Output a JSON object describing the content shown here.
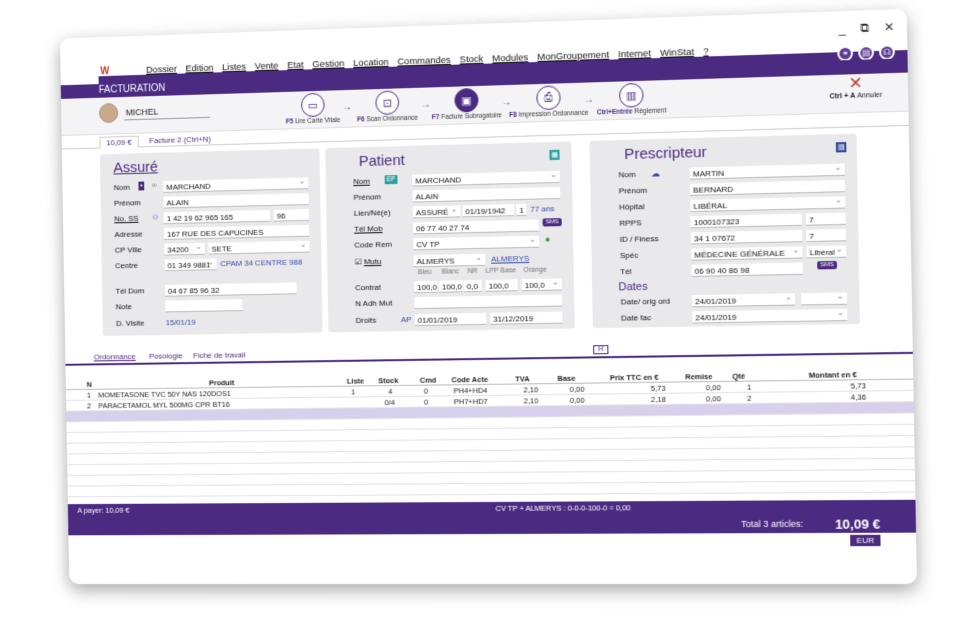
{
  "window": {
    "minimize": "_",
    "restore": "⧉",
    "close": "✕"
  },
  "menu": [
    "Dossier",
    "Edition",
    "Listes",
    "Vente",
    "Etat",
    "Gestion",
    "Location",
    "Commandes",
    "Stock",
    "Modules",
    "MonGroupement",
    "Internet",
    "WinStat",
    "?"
  ],
  "title": "FACTURATION",
  "client": "MICHEL",
  "steps": [
    {
      "key": "F5",
      "label": "Lire Carte Vitale"
    },
    {
      "key": "F6",
      "label": "Scan Ordonnance"
    },
    {
      "key": "F7",
      "label": "Facture Subrogatoire"
    },
    {
      "key": "F8",
      "label": "Impression Ordonnance"
    },
    {
      "key": "Ctrl+Entrée",
      "label": "Règlement"
    }
  ],
  "cancel": {
    "key": "Ctrl + A",
    "label": "Annuler"
  },
  "tabs": [
    "10,09 €",
    "Facture 2 (Ctrl+N)"
  ],
  "assure": {
    "title": "Assuré",
    "nom_label": "Nom",
    "nom": "MARCHAND",
    "prenom_label": "Prénom",
    "prenom": "ALAIN",
    "ss_label": "No. SS",
    "ss": "1 42 19 62 965 165",
    "ss_key": "96",
    "adresse_label": "Adresse",
    "adresse": "167 RUE DES CAPUCINES",
    "cp_label": "CP Ville",
    "cp": "34200",
    "ville": "SETE",
    "centre_label": "Centre",
    "centre": "01 349 9881",
    "centre_name": "CPAM 34 CENTRE 988",
    "tel_label": "Tél Dom",
    "tel": "04 67 85 96 32",
    "note_label": "Note",
    "visite_label": "D. Visite",
    "visite": "15/01/19"
  },
  "patient": {
    "title": "Patient",
    "nom_label": "Nom",
    "ep": "EP",
    "nom": "MARCHAND",
    "prenom_label": "Prénom",
    "prenom": "ALAIN",
    "lien_label": "Lien/Né(e)",
    "lien": "ASSURÉ",
    "dob": "01/19/1942",
    "rang": "1",
    "age": "77 ans",
    "tel_label": "Tél Mob",
    "tel": "06 77 40 27 74",
    "sms": "SMS",
    "code_label": "Code Rem",
    "code": "CV TP",
    "mutu_label": "Mutu",
    "mutu": "ALMERYS",
    "mutu_link": "ALMERYS",
    "cols": [
      "Bleu",
      "Blanc",
      "NR",
      "LPP Base",
      "Orange"
    ],
    "contrat_label": "Contrat",
    "contrat": [
      "100,0",
      "100,0",
      "0,0",
      "100,0",
      "100,0"
    ],
    "adh_label": "N Adh Mut",
    "droits_label": "Droits",
    "droits_ap": "AP",
    "droits_from": "01/01/2019",
    "droits_to": "31/12/2019"
  },
  "prescripteur": {
    "title": "Prescripteur",
    "nom_label": "Nom",
    "nom": "MARTIN",
    "prenom_label": "Prénom",
    "prenom": "BERNARD",
    "hopital_label": "Hôpital",
    "hopital": "LIBÉRAL",
    "rpps_label": "RPPS",
    "rpps": "1000107323",
    "rpps_key": "7",
    "finess_label": "ID / Finess",
    "finess": "34 1 07672",
    "finess_key": "7",
    "spec_label": "Spéc",
    "spec": "MÉDECINE GÉNÉRALE",
    "spec_type": "Libéral",
    "tel_label": "Tél",
    "tel": "06 90 40 86 98",
    "sms": "SMS",
    "dates_title": "Dates",
    "ord_label": "Date/ orig ord",
    "ord": "24/01/2019",
    "fac_label": "Date fac",
    "fac": "24/01/2019"
  },
  "lower_tabs": [
    "Ordonnance",
    "Posologie",
    "Fiche de travail"
  ],
  "h_button": "H",
  "grid": {
    "headers": [
      "N",
      "Produit",
      "Liste",
      "Stock",
      "Cmd",
      "Code Acte",
      "TVA",
      "Base",
      "Prix TTC en €",
      "Remise",
      "Qté",
      "Montant en €"
    ],
    "rows": [
      [
        "1",
        "MOMETASONE TVC 50Y NAS 120DOS1",
        "1",
        "4",
        "0",
        "PH4+HD4",
        "2,10",
        "0,00",
        "5,73",
        "0,00",
        "1",
        "5,73"
      ],
      [
        "2",
        "PARACETAMOL MYL 500MG CPR BT16",
        "",
        "0/4",
        "0",
        "PH7+HD7",
        "2,10",
        "0,00",
        "2,18",
        "0,00",
        "2",
        "4,36"
      ]
    ]
  },
  "footer": {
    "a_payer": "A payer: 10,09 €",
    "cv": "CV TP + ALMERYS : 0-0-0-100-0 = 0,00",
    "total_label": "Total 3 articles:",
    "total": "10,09 €",
    "currency": "EUR"
  }
}
